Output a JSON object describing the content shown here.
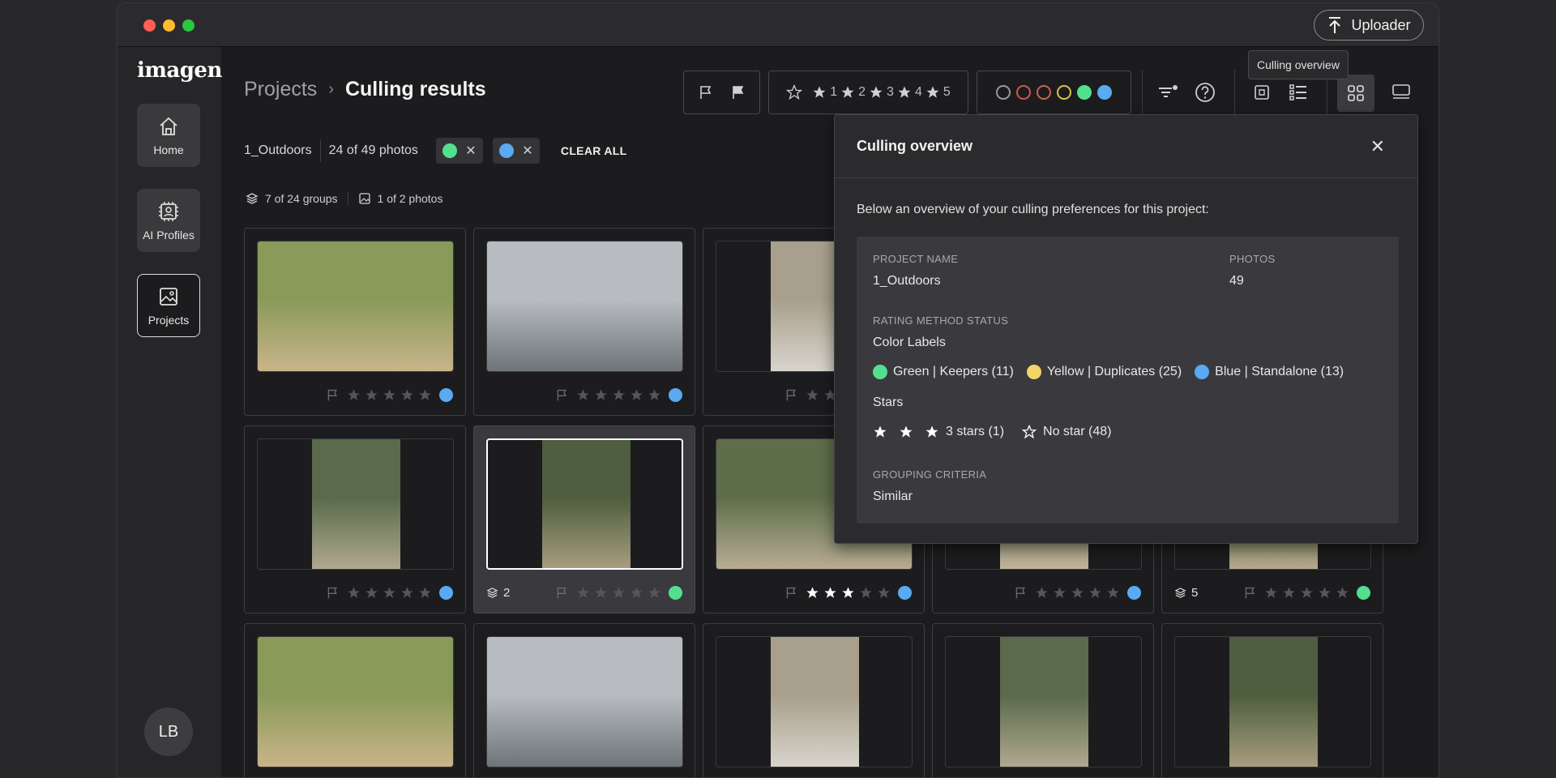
{
  "colors": {
    "green": "#52e08f",
    "yellow": "#f3d46b",
    "blue": "#5aaaf2",
    "red": "#d0564f",
    "orange": "#c9624c",
    "yellow_outline": "#d9c54a"
  },
  "header": {
    "uploader_label": "Uploader"
  },
  "sidebar": {
    "logo": "imagen",
    "items": [
      {
        "label": "Home",
        "icon": "home-icon"
      },
      {
        "label": "AI Profiles",
        "icon": "ai-profile-icon"
      },
      {
        "label": "Projects",
        "icon": "image-icon"
      }
    ],
    "avatar": "LB"
  },
  "breadcrumb": {
    "parent": "Projects",
    "current": "Culling results"
  },
  "toolbar": {
    "star_labels": [
      "1",
      "2",
      "3",
      "4",
      "5"
    ],
    "tooltip": "Culling overview"
  },
  "filters": {
    "project": "1_Outdoors",
    "count": "24 of 49 photos",
    "clear_all": "CLEAR ALL"
  },
  "groups": {
    "groups": "7 of 24 groups",
    "photos": "1 of 2 photos"
  },
  "cards": [
    {
      "stars": 0,
      "color": "blue",
      "group": ""
    },
    {
      "stars": 0,
      "color": "blue",
      "group": ""
    },
    {
      "stars": 0,
      "color": "blue",
      "group": ""
    },
    {
      "stars": 0,
      "color": "blue",
      "group": ""
    },
    {
      "stars": 0,
      "color": "green",
      "group": "2"
    },
    {
      "stars": 3,
      "color": "blue",
      "group": ""
    },
    {
      "stars": 0,
      "color": "blue",
      "group": ""
    },
    {
      "stars": 0,
      "color": "green",
      "group": "5"
    }
  ],
  "overview": {
    "title": "Culling overview",
    "close": "✕",
    "description": "Below an overview of your culling preferences for this project:",
    "project_name_label": "PROJECT NAME",
    "project_name": "1_Outdoors",
    "photos_label": "PHOTOS",
    "photos": "49",
    "rating_label": "RATING METHOD STATUS",
    "color_labels_title": "Color Labels",
    "color_labels": [
      {
        "color": "green",
        "text": "Green | Keepers (11)"
      },
      {
        "color": "yellow",
        "text": "Yellow | Duplicates (25)"
      },
      {
        "color": "blue",
        "text": "Blue | Standalone (13)"
      }
    ],
    "stars_title": "Stars",
    "stars_3": "3 stars (1)",
    "no_star": "No star (48)",
    "grouping_label": "GROUPING CRITERIA",
    "grouping": "Similar"
  }
}
